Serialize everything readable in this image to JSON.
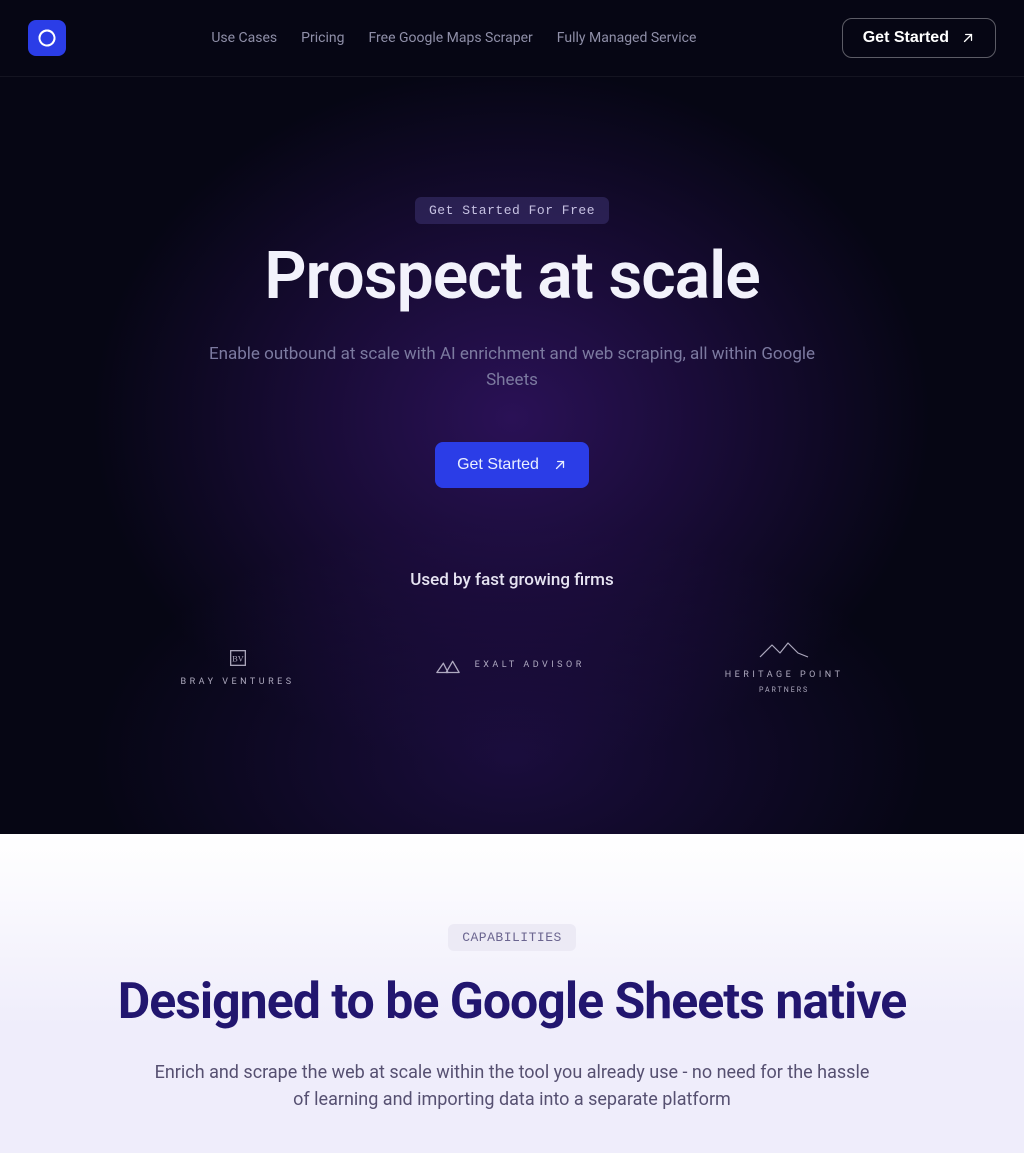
{
  "nav": {
    "links": [
      "Use Cases",
      "Pricing",
      "Free Google Maps Scraper",
      "Fully Managed Service"
    ],
    "cta": "Get Started"
  },
  "hero": {
    "pill": "Get Started For Free",
    "title": "Prospect at scale",
    "subtitle": "Enable outbound at scale with AI enrichment and web scraping, all within Google Sheets",
    "cta": "Get Started",
    "usedby": "Used by fast growing firms",
    "firms": [
      {
        "name": "BRAY VENTURES"
      },
      {
        "name": "EXALT ADVISOR"
      },
      {
        "name": "HERITAGE POINT",
        "sub": "PARTNERS"
      }
    ]
  },
  "capabilities": {
    "pill": "CAPABILITIES",
    "title": "Designed to be Google Sheets native",
    "subtitle": "Enrich and scrape the web at scale within the tool you already use - no need for the hassle of learning and importing data into a separate platform"
  }
}
